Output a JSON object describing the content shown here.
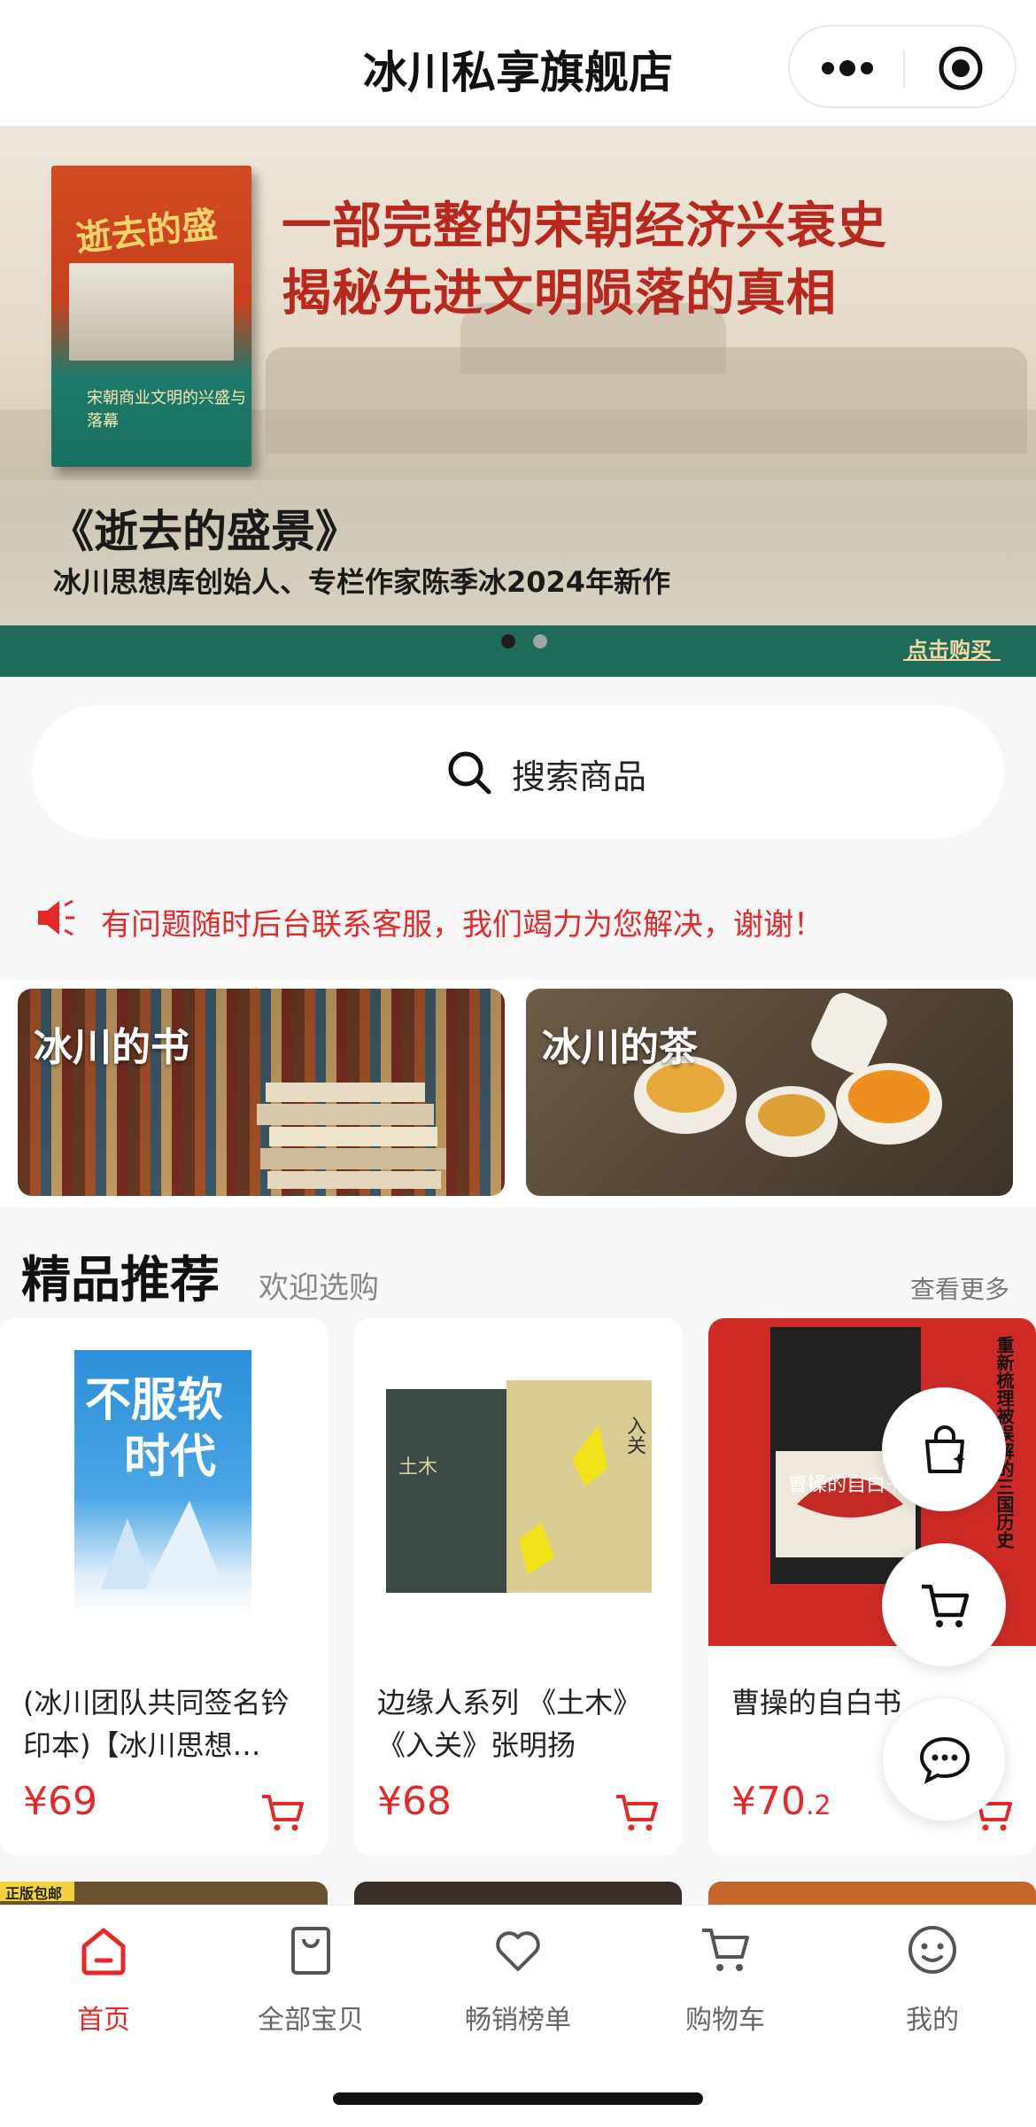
{
  "header": {
    "title": "冰川私享旗舰店"
  },
  "banner": {
    "headline_line1": "一部完整的宋朝经济兴衰史",
    "headline_line2": "揭秘先进文明陨落的真相",
    "book_title": "《逝去的盛景》",
    "subtitle": "冰川思想库创始人、专栏作家陈季冰2024年新作",
    "cta": "点击购买",
    "cover_title": "逝去的盛景",
    "cover_subtitle": "宋朝商业文明的兴盛与落幕",
    "dots": {
      "count": 2,
      "active": 0
    },
    "colors": {
      "headline": "#b8281e",
      "strip": "#1f6b5a"
    }
  },
  "search": {
    "placeholder": "搜索商品"
  },
  "notice": {
    "text": "有问题随时后台联系客服，我们竭力为您解决，谢谢！",
    "color": "#e62828"
  },
  "categories": [
    {
      "label": "冰川的书"
    },
    {
      "label": "冰川的茶"
    }
  ],
  "section": {
    "title": "精品推荐",
    "subtitle": "欢迎选购",
    "more": "查看更多"
  },
  "products": [
    {
      "name": "(冰川团队共同签名钤印本)【冰川思想…",
      "price_main": "¥69",
      "price_decimal": "",
      "cover_text_1": "不服软",
      "cover_text_2": "时代"
    },
    {
      "name": "边缘人系列 《土木》《入关》张明扬",
      "price_main": "¥68",
      "price_decimal": "",
      "cover_text_1": "土木",
      "cover_text_2": "入关"
    },
    {
      "name": "曹操的自白书",
      "price_main": "¥70",
      "price_decimal": ".2",
      "cover_text_1": "曹操的自白书",
      "cover_text_2": "重新梳理被误解的三国历史"
    }
  ],
  "peek_badge": "正版包邮",
  "tabs": [
    {
      "label": "首页",
      "icon": "home-icon",
      "active": true
    },
    {
      "label": "全部宝贝",
      "icon": "bag-icon",
      "active": false
    },
    {
      "label": "畅销榜单",
      "icon": "heart-icon",
      "active": false
    },
    {
      "label": "购物车",
      "icon": "cart-icon",
      "active": false
    },
    {
      "label": "我的",
      "icon": "profile-icon",
      "active": false
    }
  ],
  "accent_color": "#e62828"
}
